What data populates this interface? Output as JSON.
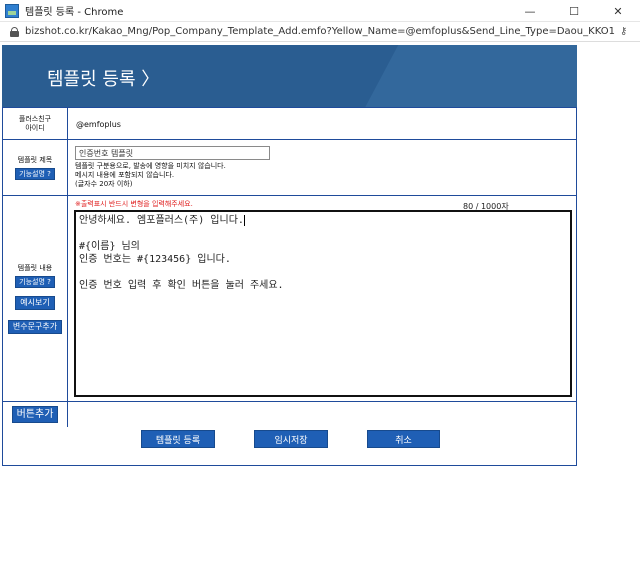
{
  "window": {
    "title": "템플릿 등록 - Chrome",
    "minimize_glyph": "—",
    "maximize_glyph": "☐",
    "close_glyph": "✕"
  },
  "browser": {
    "url": "bizshot.co.kr/Kakao_Mng/Pop_Company_Template_Add.emfo?Yellow_Name=@emfoplus&Send_Line_Type=Daou_KKO1&Yellow_L..."
  },
  "header": {
    "title": "템플릿 등록 〉"
  },
  "form": {
    "sender": {
      "label_line1": "플러스친구",
      "label_line2": "아이디",
      "value": "@emfoplus"
    },
    "template_title": {
      "label": "템플릿 제목",
      "help_button": "기능설명 ?",
      "input_value": "인증번호 템플릿",
      "help_line1": "템플릿 구분용으로, 발송에 영향을 미치지 않습니다.",
      "help_line2": "메시지 내용에 포함되지 않습니다.",
      "help_line3": "(글자수 20자 이하)"
    },
    "template_content": {
      "label": "템플릿 내용",
      "help_button": "기능설명 ?",
      "preview_button": "예시보기",
      "add_variable_button": "변수문구추가",
      "warning": "※출력표시 반드시 변형을 입력해주세요.",
      "counter": "80 / 1000자",
      "lines": [
        "안녕하세요. 엠포플러스(주) 입니다.",
        "",
        "#{이름} 님의",
        "인증 번호는 #{123456} 입니다.",
        "",
        "인증 번호 입력 후 확인 버튼을 눌러 주세요."
      ]
    },
    "add_button": {
      "label": "버튼추가"
    }
  },
  "actions": {
    "register": "템플릿 등록",
    "temp_save": "임시저장",
    "cancel": "취소"
  },
  "colors": {
    "header_blue": "#2a5d91",
    "button_blue": "#1f5fb5",
    "border_blue": "#1f4b9b",
    "warning_red": "#e02020"
  }
}
